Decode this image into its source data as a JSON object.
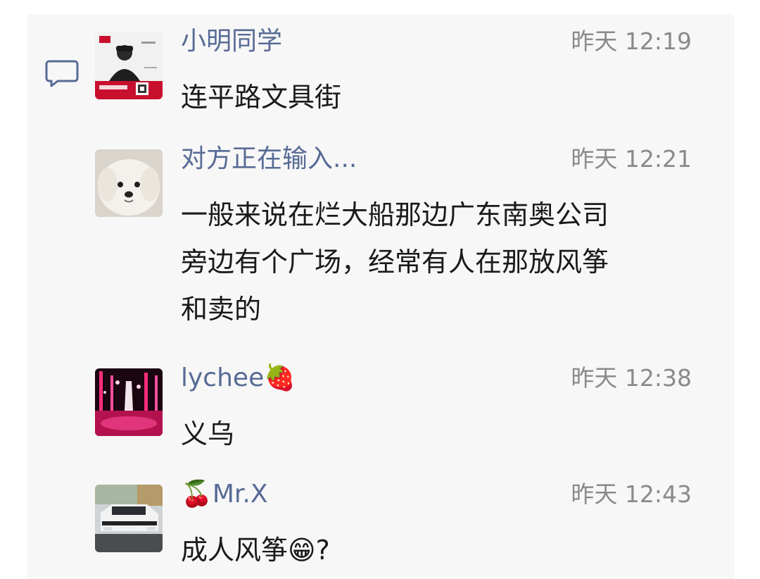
{
  "comments": [
    {
      "name": "小明同学",
      "time": "昨天 12:19",
      "lines": [
        "连平路文具街"
      ],
      "avatar_icon": "man-poster-avatar"
    },
    {
      "name": "对方正在输入...",
      "time": "昨天 12:21",
      "lines": [
        "一般来说在烂大船那边广东南奥公司",
        "旁边有个广场，经常有人在那放风筝",
        "和卖的"
      ],
      "avatar_icon": "white-dog-avatar"
    },
    {
      "name": "lychee🍓",
      "time": "昨天 12:38",
      "lines": [
        "义乌"
      ],
      "avatar_icon": "neon-lights-avatar"
    },
    {
      "name": "🍒Mr.X",
      "time": "昨天 12:43",
      "lines": [
        "成人风筝😁?"
      ],
      "avatar_icon": "white-car-avatar"
    }
  ],
  "colors": {
    "name": "#576b95",
    "time": "#8a8a8a",
    "text": "#1a1a1a",
    "panel_bg": "#f7f7f7"
  },
  "icons": {
    "section_icon": "comment-icon"
  }
}
